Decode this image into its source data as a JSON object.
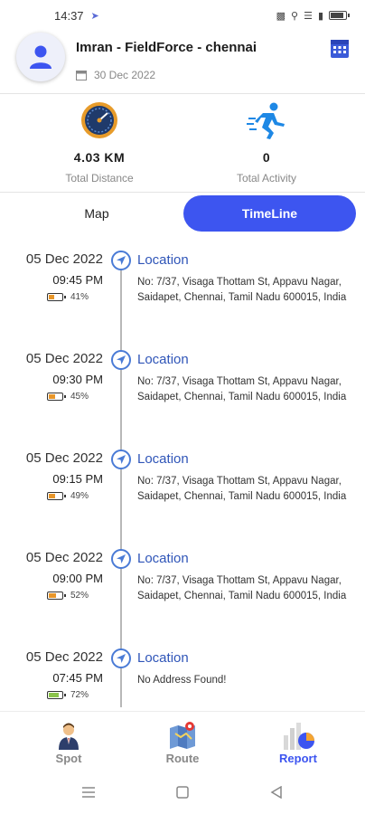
{
  "status_bar": {
    "time": "14:37"
  },
  "header": {
    "user_name": "Imran - FieldForce - chennai",
    "date": "30 Dec 2022",
    "avatar_icon": "person-icon",
    "calendar_icon": "calendar-icon"
  },
  "stats": {
    "distance": {
      "value": "4.03 KM",
      "label": "Total Distance",
      "icon": "speedometer-icon"
    },
    "activity": {
      "value": "0",
      "label": "Total Activity",
      "icon": "runner-icon"
    }
  },
  "tabs": {
    "map": "Map",
    "timeline": "TimeLine",
    "active": "timeline"
  },
  "timeline": [
    {
      "date": "05 Dec 2022",
      "time": "09:45 PM",
      "battery": "41%",
      "battery_level": 0.41,
      "battery_color": "#e8962a",
      "title": "Location",
      "address": "No: 7/37, Visaga Thottam St, Appavu Nagar, Saidapet, Chennai, Tamil Nadu 600015, India"
    },
    {
      "date": "05 Dec 2022",
      "time": "09:30 PM",
      "battery": "45%",
      "battery_level": 0.45,
      "battery_color": "#e8962a",
      "title": "Location",
      "address": "No: 7/37, Visaga Thottam St, Appavu Nagar, Saidapet, Chennai, Tamil Nadu 600015, India"
    },
    {
      "date": "05 Dec 2022",
      "time": "09:15 PM",
      "battery": "49%",
      "battery_level": 0.49,
      "battery_color": "#e8962a",
      "title": "Location",
      "address": "No: 7/37, Visaga Thottam St, Appavu Nagar, Saidapet, Chennai, Tamil Nadu 600015, India"
    },
    {
      "date": "05 Dec 2022",
      "time": "09:00 PM",
      "battery": "52%",
      "battery_level": 0.52,
      "battery_color": "#e8962a",
      "title": "Location",
      "address": "No: 7/37, Visaga Thottam St, Appavu Nagar, Saidapet, Chennai, Tamil Nadu 600015, India"
    },
    {
      "date": "05 Dec 2022",
      "time": "07:45 PM",
      "battery": "72%",
      "battery_level": 0.72,
      "battery_color": "#8bc34a",
      "title": "Location",
      "address": "No Address Found!"
    }
  ],
  "bottom_nav": {
    "spot": {
      "label": "Spot",
      "icon": "agent-icon"
    },
    "route": {
      "label": "Route",
      "icon": "map-pin-icon"
    },
    "report": {
      "label": "Report",
      "icon": "report-chart-icon"
    },
    "active": "report"
  },
  "colors": {
    "accent": "#3d55f0",
    "link": "#2f55b8",
    "marker": "#4a7bd6"
  }
}
